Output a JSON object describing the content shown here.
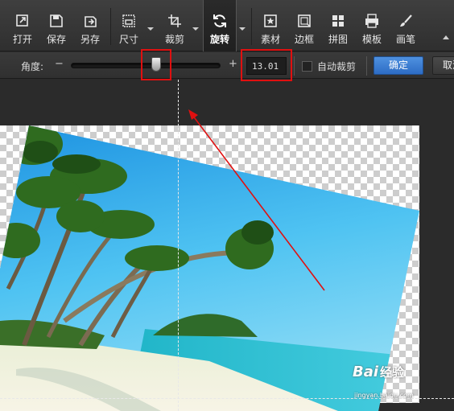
{
  "toolbar": {
    "items": [
      {
        "label": "打开",
        "icon": "open-icon"
      },
      {
        "label": "保存",
        "icon": "save-icon"
      },
      {
        "label": "另存",
        "icon": "save-as-icon"
      },
      {
        "label": "尺寸",
        "icon": "resize-icon"
      },
      {
        "label": "裁剪",
        "icon": "crop-icon"
      },
      {
        "label": "旋转",
        "icon": "rotate-icon",
        "active": true
      },
      {
        "label": "素材",
        "icon": "material-icon"
      },
      {
        "label": "边框",
        "icon": "frame-icon"
      },
      {
        "label": "拼图",
        "icon": "collage-icon"
      },
      {
        "label": "模板",
        "icon": "template-icon"
      },
      {
        "label": "画笔",
        "icon": "brush-icon"
      }
    ]
  },
  "rotate_options": {
    "angle_label": "角度:",
    "minus": "−",
    "plus": "+",
    "angle_value": "13.01",
    "angle_slider_fraction": 0.62,
    "auto_crop_label": "自动裁剪",
    "auto_crop_checked": false,
    "ok_label": "确定",
    "cancel_label": "取消"
  },
  "watermark": {
    "logo": "Bai",
    "logo_suffix": "经验",
    "url": "jingyan.baidu.com"
  },
  "colors": {
    "accent_blue": "#2d6cc4",
    "highlight_red": "#e01010"
  }
}
